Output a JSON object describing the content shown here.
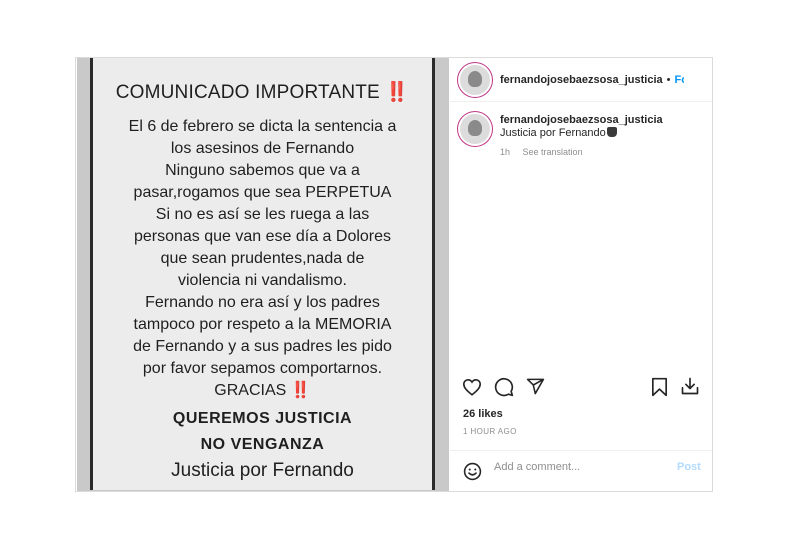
{
  "poster": {
    "title": "COMUNICADO IMPORTANTE",
    "title_mark": "‼️",
    "lines": [
      "El 6 de febrero se dicta la sentencia a",
      "los asesinos de Fernando",
      "Ninguno sabemos que va a",
      "pasar,rogamos que sea PERPETUA",
      "Si no es así se les ruega a las",
      "personas que van ese día a Dolores",
      "que sean prudentes,nada de",
      "violencia ni vandalismo.",
      "Fernando no era así y los padres",
      "tampoco por respeto a la MEMORIA",
      "de Fernando y a sus padres les pido",
      "por favor sepamos comportarnos."
    ],
    "gracias": "GRACIAS",
    "gracias_mark": "‼️",
    "strong1": "QUEREMOS JUSTICIA",
    "strong2": "NO VENGANZA",
    "signoff": "Justicia por Fernando"
  },
  "header": {
    "username": "fernandojosebaezsosa_justicia",
    "separator": "•",
    "follow": "Follow"
  },
  "caption": {
    "username": "fernandojosebaezsosa_justicia",
    "text": "Justicia por Fernando",
    "time": "1h",
    "translate": "See translation"
  },
  "likes": "26 likes",
  "timestamp": "1 HOUR AGO",
  "comment": {
    "placeholder": "Add a comment...",
    "post": "Post"
  },
  "icons": {
    "like": "heart-icon",
    "comment": "comment-icon",
    "share": "share-icon",
    "save": "bookmark-icon",
    "download": "download-icon",
    "emoji": "emoji-icon",
    "caption_emoji": "trophy-icon"
  },
  "colors": {
    "follow": "#0095f6",
    "mark": "#d9261c",
    "muted": "#8e8e8e",
    "post_disabled": "#b3dbff"
  }
}
